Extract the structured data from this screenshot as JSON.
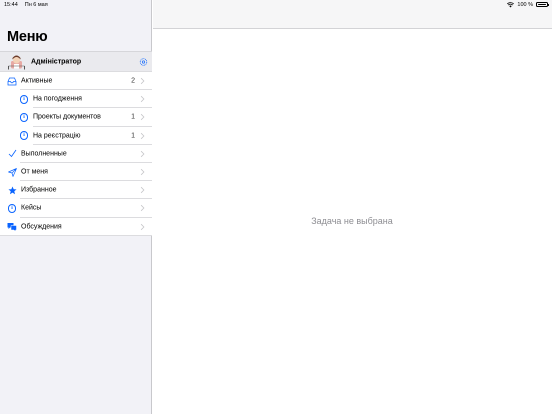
{
  "status_bar": {
    "time": "15:44",
    "date": "Пн 6 мая",
    "battery": "100 %",
    "icons": [
      "wifi-icon",
      "battery-icon"
    ]
  },
  "sidebar": {
    "title": "Меню",
    "user": {
      "name": "Адміністратор",
      "icons": [
        "avatar",
        "gear-icon"
      ]
    },
    "items": [
      {
        "label": "Активные",
        "count": "2",
        "icon": "inbox-icon"
      },
      {
        "label": "На погодження",
        "count": "",
        "icon": "info-icon"
      },
      {
        "label": "Проекты документов",
        "count": "1",
        "icon": "info-icon"
      },
      {
        "label": "На реєстрацію",
        "count": "1",
        "icon": "info-icon"
      },
      {
        "label": "Выполненные",
        "count": "",
        "icon": "checkmark-icon"
      },
      {
        "label": "От меня",
        "count": "",
        "icon": "paper-plane-icon"
      },
      {
        "label": "Избранное",
        "count": "",
        "icon": "star-icon"
      },
      {
        "label": "Кейсы",
        "count": "",
        "icon": "info-icon"
      },
      {
        "label": "Обсуждения",
        "count": "",
        "icon": "chat-bubbles-icon"
      }
    ]
  },
  "detail": {
    "empty_text": "Задача не выбрана"
  },
  "colors": {
    "accent": "#0a64ff",
    "sidebar_bg": "#f2f2f7",
    "secondary_text": "#8e8e93"
  }
}
